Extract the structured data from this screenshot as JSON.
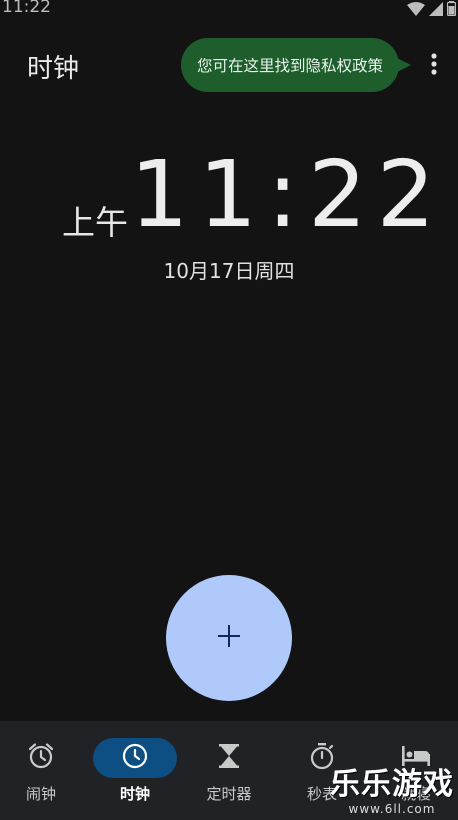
{
  "status_bar": {
    "time": "11:22"
  },
  "app_bar": {
    "title": "时钟"
  },
  "tooltip": {
    "text": "您可在这里找到隐私权政策"
  },
  "clock": {
    "ampm": "上午",
    "time": "11:22",
    "date": "10月17日周四"
  },
  "fab": {
    "icon": "plus-icon"
  },
  "bottom_nav": {
    "items": [
      {
        "key": "alarm",
        "label": "闹钟",
        "icon": "alarm-clock-icon",
        "active": false
      },
      {
        "key": "clock",
        "label": "时钟",
        "icon": "clock-icon",
        "active": true
      },
      {
        "key": "timer",
        "label": "定时器",
        "icon": "hourglass-icon",
        "active": false
      },
      {
        "key": "stopwatch",
        "label": "秒表",
        "icon": "stopwatch-icon",
        "active": false
      },
      {
        "key": "bedtime",
        "label": "就寝",
        "icon": "bed-icon",
        "active": false
      }
    ]
  },
  "watermark": {
    "main": "乐乐游戏",
    "sub": "www.6ll.com"
  },
  "colors": {
    "background": "#131313",
    "tooltip": "#1e5d2c",
    "fab": "#afc9fb",
    "nav_bg": "#202226",
    "nav_active": "#0d4f82"
  }
}
